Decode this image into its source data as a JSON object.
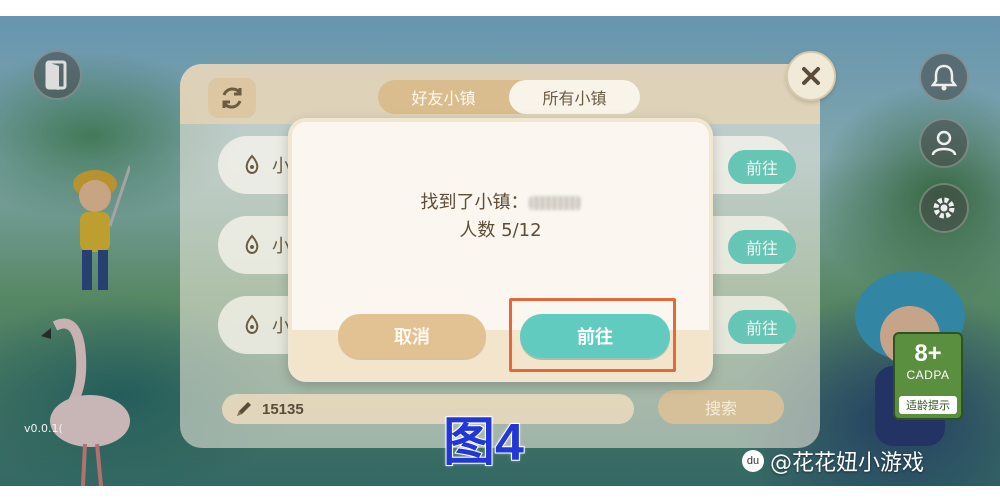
{
  "panel": {
    "tabs": [
      {
        "label": "好友小镇",
        "active": false
      },
      {
        "label": "所有小镇",
        "active": true
      }
    ],
    "rows": [
      {
        "name": "小",
        "go_label": "前往"
      },
      {
        "name": "小",
        "go_label": "前往"
      },
      {
        "name": "小",
        "go_label": "前往"
      }
    ],
    "search": {
      "value": "15135",
      "button_label": "搜索"
    }
  },
  "dialog": {
    "found_prefix": "找到了小镇：",
    "count_text": "人数 5/12",
    "cancel_label": "取消",
    "confirm_label": "前往"
  },
  "hud": {
    "version": "v0.0.1(",
    "age_rating": "8+",
    "age_org": "CADPA",
    "age_tip": "适龄提示",
    "icons": [
      "exit-door-icon",
      "bell-icon",
      "profile-icon",
      "gear-icon",
      "refresh-icon",
      "close-icon",
      "pencil-icon"
    ]
  },
  "overlay": {
    "figure_label": "图4",
    "watermark": "@花花妞小游戏",
    "watermark_logo": "du"
  },
  "colors": {
    "teal_button": "#62cbbf",
    "cancel_button": "#e2c193",
    "highlight": "#e2693a",
    "figure_label": "#2237d6"
  }
}
